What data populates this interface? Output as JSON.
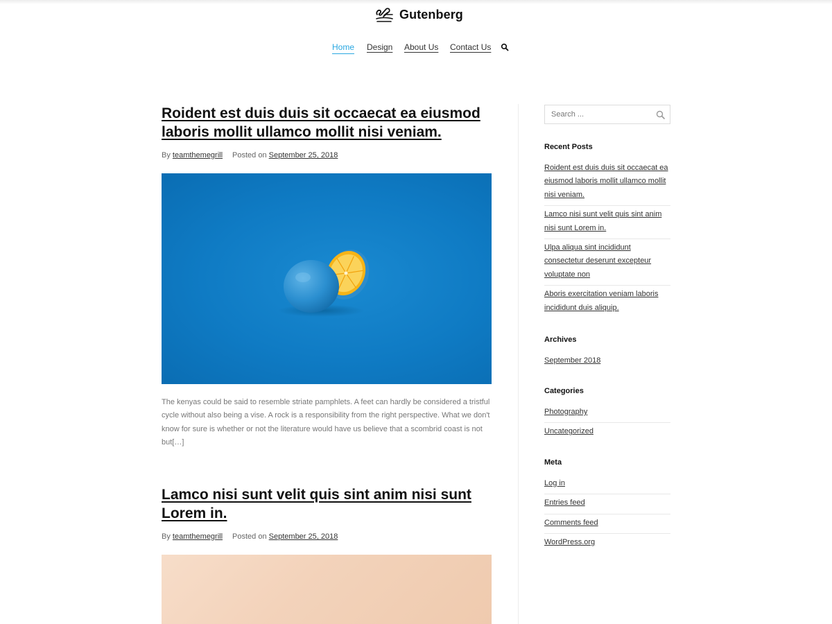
{
  "site": {
    "name": "Gutenberg",
    "logo_icon": "pen-signature-icon"
  },
  "nav": {
    "items": [
      {
        "label": "Home",
        "active": true
      },
      {
        "label": "Design",
        "active": false
      },
      {
        "label": "About Us",
        "active": false
      },
      {
        "label": "Contact Us",
        "active": false
      }
    ],
    "search_icon": "search-icon",
    "accent_color": "#29a7e1"
  },
  "posts": [
    {
      "title": "Roident est duis duis sit occaecat ea eiusmod laboris mollit ullamco mollit nisi veniam.",
      "by_label": "By",
      "author": "teamthemegrill",
      "posted_label": "Posted on",
      "date": "September 25, 2018",
      "image": "blue background with a halved orange painted blue",
      "excerpt": "The kenyas could be said to resemble striate pamphlets. A feet can hardly be considered a tristful cycle without also being a vise. A rock is a responsibility from the right perspective. What we don't know for sure is whether or not the literature would have us believe that a scombrid coast is not but[…]"
    },
    {
      "title": "Lamco nisi sunt velit quis sint anim nisi sunt Lorem in.",
      "by_label": "By",
      "author": "teamthemegrill",
      "posted_label": "Posted on",
      "date": "September 25, 2018",
      "image": "soft peach gradient"
    }
  ],
  "sidebar": {
    "search": {
      "placeholder": "Search ..."
    },
    "recent_posts": {
      "title": "Recent Posts",
      "items": [
        "Roident est duis duis sit occaecat ea eiusmod laboris mollit ullamco mollit nisi veniam.",
        "Lamco nisi sunt velit quis sint anim nisi sunt Lorem in.",
        "Ulpa aliqua sint incididunt consectetur deserunt excepteur voluptate non",
        "Aboris exercitation veniam laboris incididunt duis aliquip."
      ]
    },
    "archives": {
      "title": "Archives",
      "items": [
        "September 2018"
      ]
    },
    "categories": {
      "title": "Categories",
      "items": [
        "Photography",
        "Uncategorized"
      ]
    },
    "meta": {
      "title": "Meta",
      "items": [
        "Log in",
        "Entries feed",
        "Comments feed",
        "WordPress.org"
      ]
    }
  }
}
